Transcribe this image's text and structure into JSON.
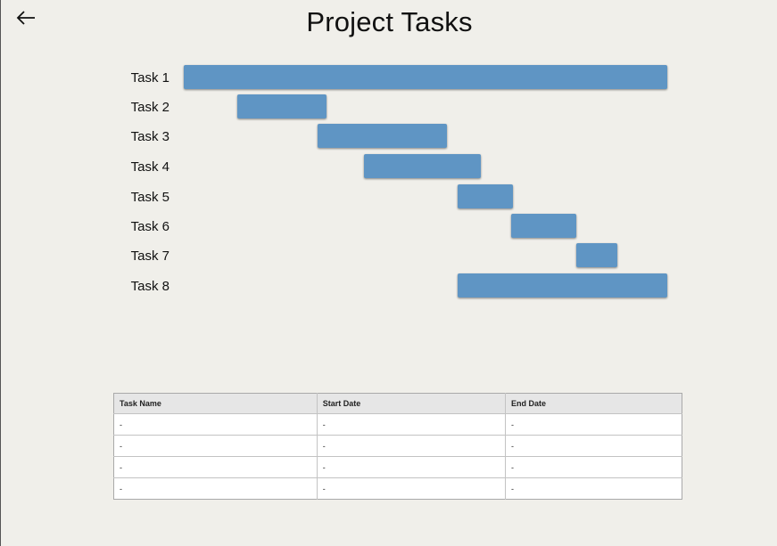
{
  "header": {
    "title": "Project Tasks",
    "back_icon": "arrow-left-icon"
  },
  "chart_data": {
    "type": "gantt",
    "categories": [
      "Task 1",
      "Task 2",
      "Task 3",
      "Task 4",
      "Task 5",
      "Task 6",
      "Task 7",
      "Task 8"
    ],
    "tasks": [
      {
        "name": "Task 1",
        "start": 0.0,
        "end": 100.0
      },
      {
        "name": "Task 2",
        "start": 11.0,
        "end": 29.6
      },
      {
        "name": "Task 3",
        "start": 27.7,
        "end": 54.4
      },
      {
        "name": "Task 4",
        "start": 37.3,
        "end": 61.4
      },
      {
        "name": "Task 5",
        "start": 56.6,
        "end": 68.0
      },
      {
        "name": "Task 6",
        "start": 67.8,
        "end": 81.2
      },
      {
        "name": "Task 7",
        "start": 81.2,
        "end": 89.6
      },
      {
        "name": "Task 8",
        "start": 56.6,
        "end": 100.0
      }
    ],
    "bar_color": "#5f95c4",
    "xlim": [
      0,
      100
    ],
    "grid": false,
    "legend": "none"
  },
  "table": {
    "columns": [
      "Task Name",
      "Start Date",
      "End Date"
    ],
    "rows": [
      [
        "-",
        "-",
        "-"
      ],
      [
        "-",
        "-",
        "-"
      ],
      [
        "-",
        "-",
        "-"
      ],
      [
        "-",
        "-",
        "-"
      ]
    ]
  },
  "colors": {
    "background": "#f0efea",
    "bar": "#5f95c4",
    "table_header": "#e6e6e6"
  }
}
